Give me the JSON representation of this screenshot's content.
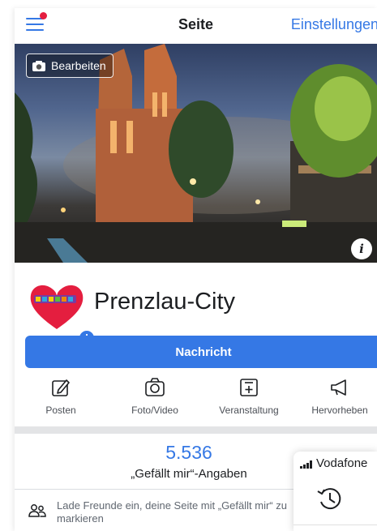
{
  "header": {
    "title": "Seite",
    "settings_label": "Einstellungen",
    "menu_icon": "hamburger-menu-icon",
    "notification_color": "#e41e3f"
  },
  "cover": {
    "edit_label": "Bearbeiten",
    "edit_icon": "camera-icon",
    "info_label": "i"
  },
  "profile": {
    "name": "Prenzlau-City",
    "avatar_icon": "heart-logo",
    "avatar_logo_text": "prenzlau"
  },
  "message_button": "Nachricht",
  "actions": [
    {
      "label": "Posten",
      "icon": "edit-icon"
    },
    {
      "label": "Foto/Video",
      "icon": "camera-icon"
    },
    {
      "label": "Veranstaltung",
      "icon": "event-icon"
    },
    {
      "label": "Hervorheben",
      "icon": "megaphone-icon"
    }
  ],
  "stats": {
    "likes_count": "5.536",
    "likes_label": "„Gefällt mir“-Angaben"
  },
  "invite": {
    "text": "Lade Freunde ein, deine Seite mit „Gefällt mir“ zu markieren",
    "icon": "friends-icon"
  },
  "ios_panel": {
    "carrier": "Vodafone",
    "icon": "history-icon"
  },
  "colors": {
    "accent": "#3578e5",
    "text": "#1c1e21",
    "muted": "#606770"
  }
}
